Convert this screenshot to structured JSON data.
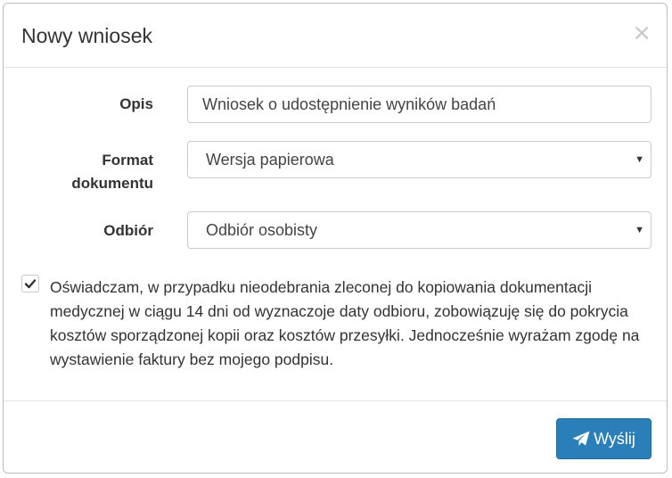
{
  "dialog": {
    "title": "Nowy wniosek",
    "close_glyph": "×"
  },
  "form": {
    "description": {
      "label": "Opis",
      "value": "Wniosek o udostępnienie wyników badań"
    },
    "document_format": {
      "label_line1": "Format",
      "label_line2": "dokumentu",
      "selected": "Wersja papierowa"
    },
    "pickup": {
      "label": "Odbiór",
      "selected": "Odbiór osobisty"
    },
    "declaration": {
      "checked": true,
      "text": "Oświadczam, w przypadku nieodebrania zleconej do kopiowania dokumentacji medycznej w ciągu 14 dni od wyznaczoje daty odbioru, zobowiązuję się do pokrycia kosztów sporządzonej kopii oraz kosztów przesyłki. Jednocześnie wyrażam zgodę na wystawienie faktury bez mojego podpisu."
    }
  },
  "footer": {
    "send_label": "Wyślij"
  },
  "icons": {
    "close": "close-icon",
    "select_arrow": "caret-down-icon",
    "checkbox": "checkmark-icon",
    "send": "paper-plane-icon"
  },
  "colors": {
    "primary_button": "#2a7fb8",
    "text": "#333333",
    "border": "#cccccc"
  }
}
